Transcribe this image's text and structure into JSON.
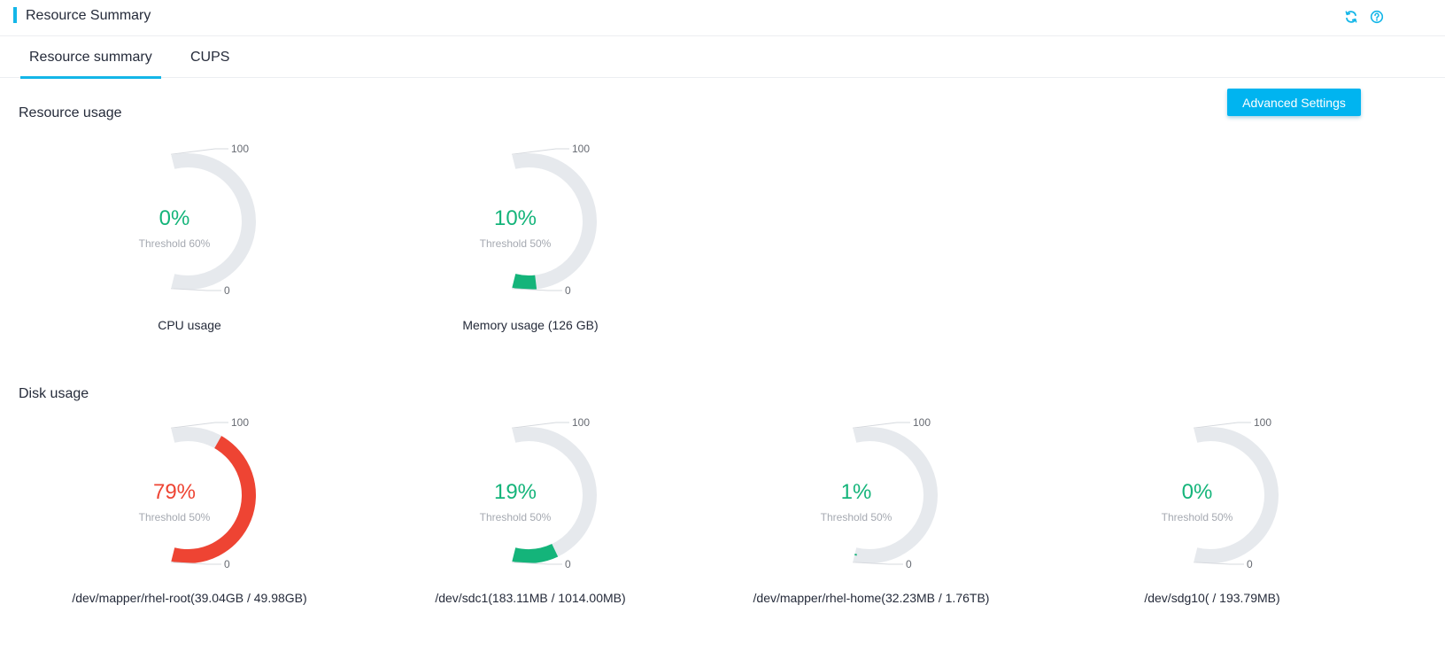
{
  "header": {
    "title": "Resource Summary",
    "refresh_icon": "refresh-icon",
    "help_icon": "help-icon"
  },
  "tabs": [
    {
      "label": "Resource summary",
      "active": true
    },
    {
      "label": "CUPS",
      "active": false
    }
  ],
  "toolbar": {
    "advanced_settings_label": "Advanced Settings"
  },
  "resource_usage": {
    "title": "Resource usage",
    "gauges": [
      {
        "label": "CPU usage",
        "percent": 0,
        "percent_text": "0%",
        "threshold_text": "Threshold 60%",
        "max_label": "100",
        "min_label": "0"
      },
      {
        "label": "Memory usage (126 GB)",
        "percent": 10,
        "percent_text": "10%",
        "threshold_text": "Threshold 50%",
        "max_label": "100",
        "min_label": "0"
      }
    ]
  },
  "disk_usage": {
    "title": "Disk usage",
    "gauges": [
      {
        "label": "/dev/mapper/rhel-root(39.04GB / 49.98GB)",
        "percent": 79,
        "percent_text": "79%",
        "threshold_text": "Threshold 50%",
        "max_label": "100",
        "min_label": "0"
      },
      {
        "label": "/dev/sdc1(183.11MB / 1014.00MB)",
        "percent": 19,
        "percent_text": "19%",
        "threshold_text": "Threshold 50%",
        "max_label": "100",
        "min_label": "0"
      },
      {
        "label": "/dev/mapper/rhel-home(32.23MB / 1.76TB)",
        "percent": 1,
        "percent_text": "1%",
        "threshold_text": "Threshold 50%",
        "max_label": "100",
        "min_label": "0"
      },
      {
        "label": "/dev/sdg10( / 193.79MB)",
        "percent": 0,
        "percent_text": "0%",
        "threshold_text": "Threshold 50%",
        "max_label": "100",
        "min_label": "0"
      }
    ]
  },
  "colors": {
    "accent": "#13b6e8",
    "button": "#00b4f0",
    "normal": "#14b47a",
    "alarm": "#ee4433",
    "track": "#e6e9ed",
    "text": "#252b3a",
    "muted": "#a5a9b1"
  }
}
